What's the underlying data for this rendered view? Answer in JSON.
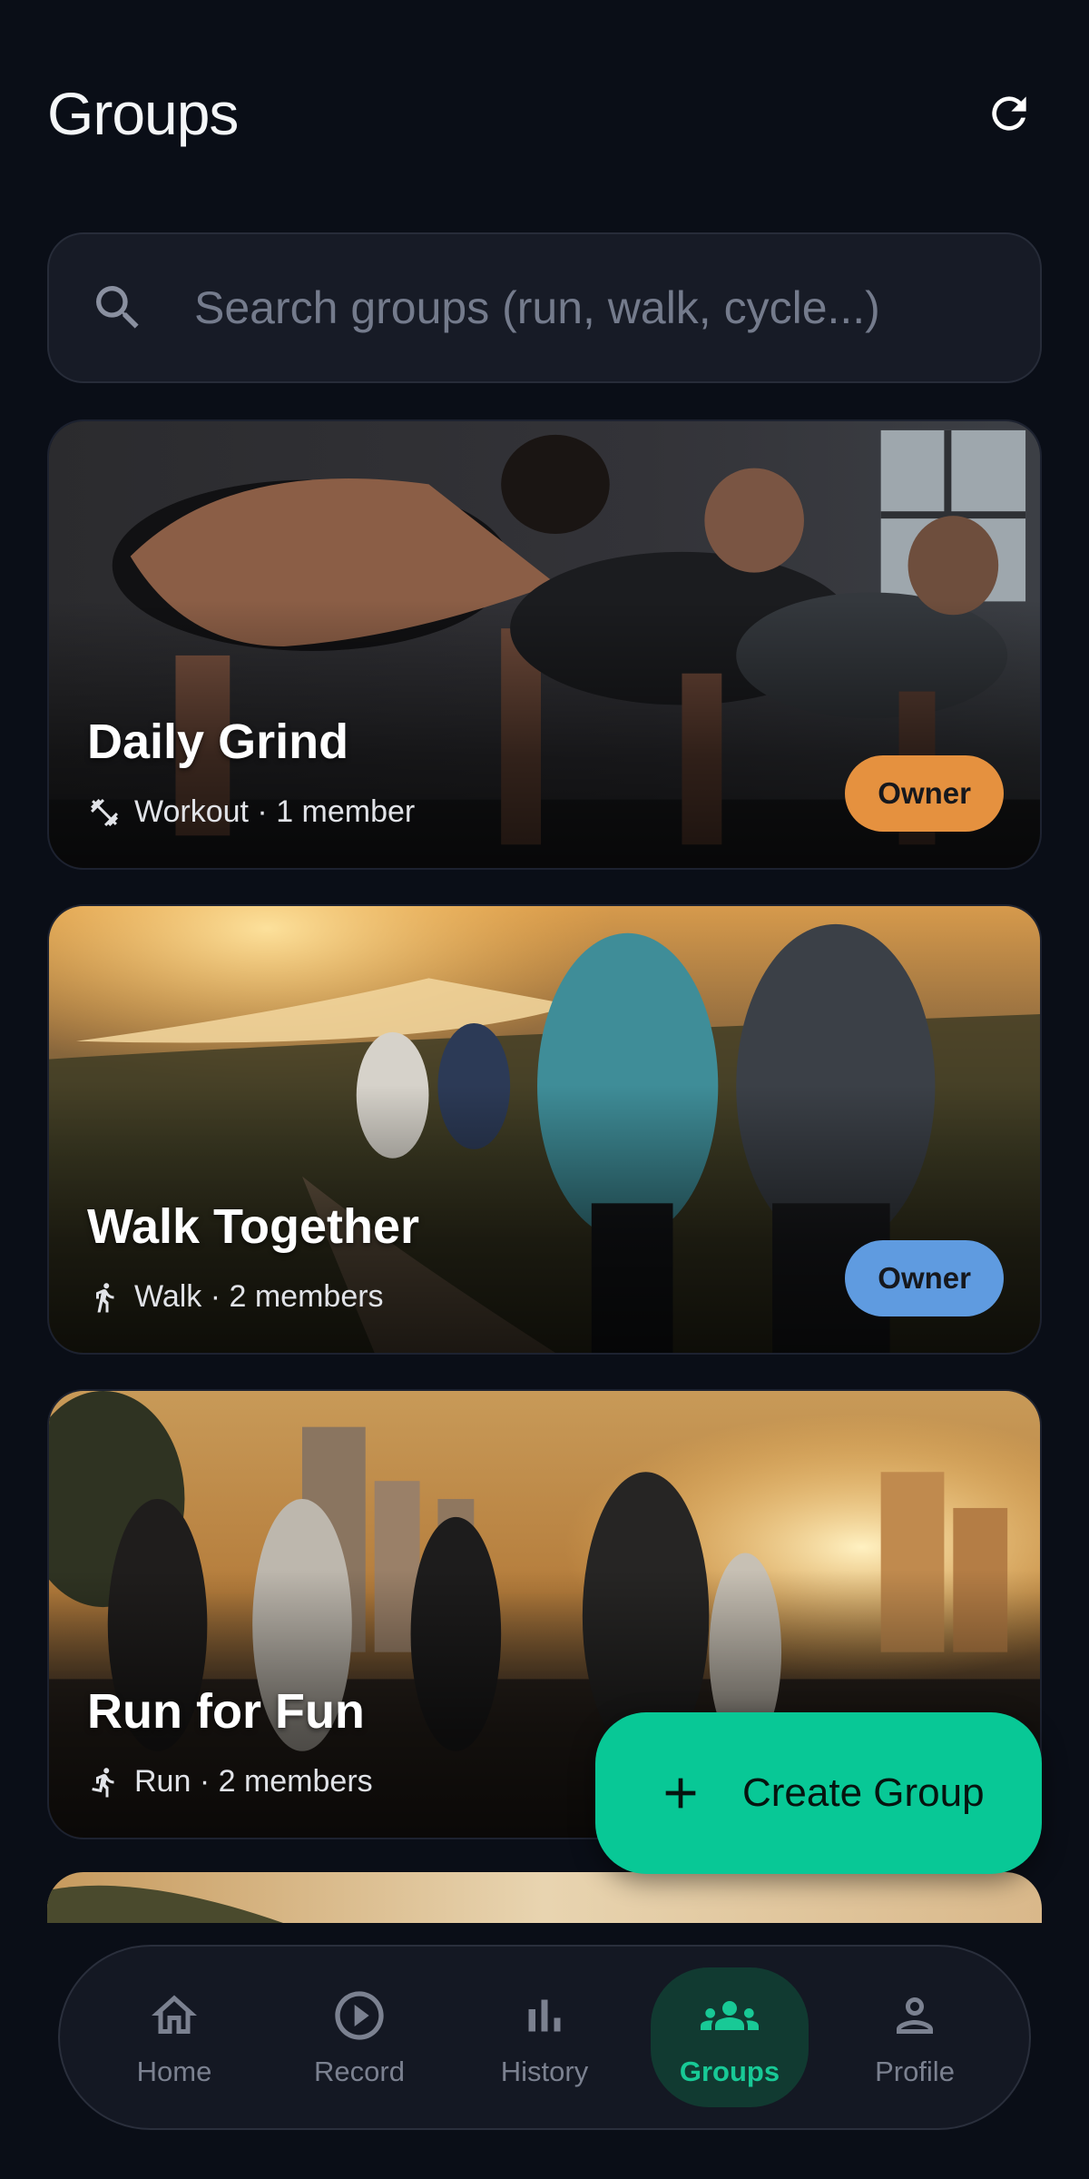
{
  "header": {
    "title": "Groups"
  },
  "search": {
    "placeholder": "Search groups (run, walk, cycle...)"
  },
  "groups": [
    {
      "name": "Daily Grind",
      "meta": "Workout · 1 member",
      "activity_icon": "workout-icon",
      "badge": "Owner",
      "badge_color": "#e5913f"
    },
    {
      "name": "Walk Together",
      "meta": "Walk · 2 members",
      "activity_icon": "walk-icon",
      "badge": "Owner",
      "badge_color": "#5f9be0"
    },
    {
      "name": "Run for Fun",
      "meta": "Run · 2 members",
      "activity_icon": "run-icon"
    }
  ],
  "fab": {
    "label": "Create Group",
    "icon": "plus-icon",
    "color": "#08c896"
  },
  "nav": {
    "items": [
      {
        "label": "Home",
        "icon": "home-icon"
      },
      {
        "label": "Record",
        "icon": "play-circle-icon"
      },
      {
        "label": "History",
        "icon": "bar-chart-icon"
      },
      {
        "label": "Groups",
        "icon": "groups-icon",
        "active": true
      },
      {
        "label": "Profile",
        "icon": "person-icon"
      }
    ],
    "active_color": "#18c996"
  }
}
